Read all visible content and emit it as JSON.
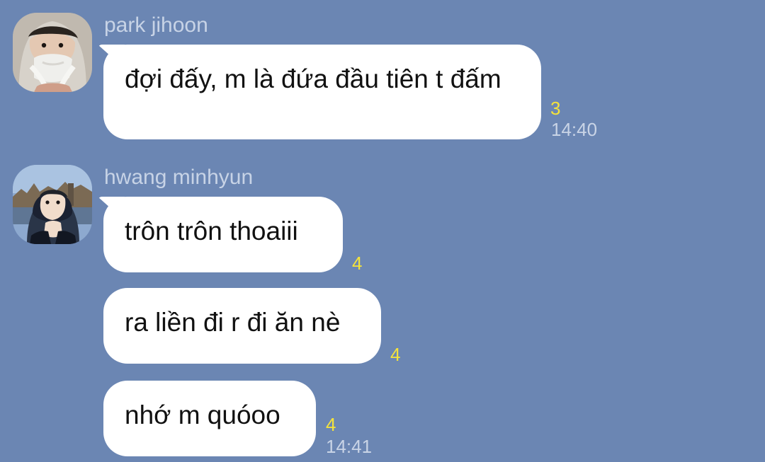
{
  "colors": {
    "background": "#6b86b3",
    "bubble": "#ffffff",
    "unread": "#f5e33b",
    "name": "#c7d3e6",
    "time": "#c9d4e6"
  },
  "groups": [
    {
      "sender": "park jihoon",
      "avatar_icon": "profile-photo-hoodie",
      "messages": [
        {
          "text": "đợi đấy, m là đứa đầu tiên t đấm",
          "unread": "3",
          "time": "14:40"
        }
      ]
    },
    {
      "sender": "hwang minhyun",
      "avatar_icon": "profile-photo-winter-jacket",
      "messages": [
        {
          "text": "trôn trôn thoaiii",
          "unread": "4",
          "time": ""
        },
        {
          "text": "ra liền đi r đi ăn nè",
          "unread": "4",
          "time": ""
        },
        {
          "text": "nhớ m quóoo",
          "unread": "4",
          "time": "14:41"
        }
      ]
    }
  ]
}
